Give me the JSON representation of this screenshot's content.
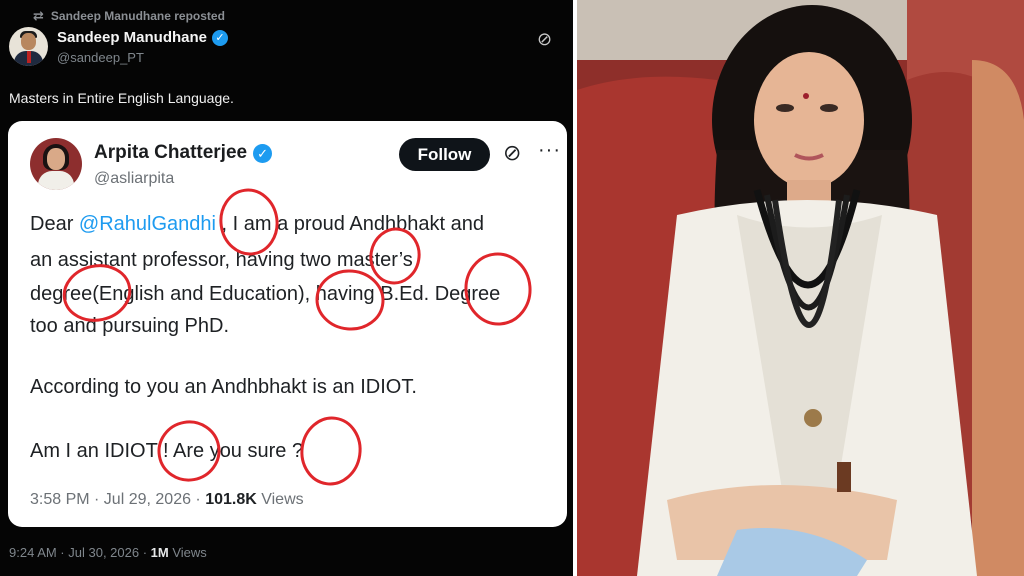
{
  "repost": {
    "text": "Sandeep Manudhane reposted"
  },
  "outer_tweet": {
    "name": "Sandeep Manudhane",
    "handle": "@sandeep_PT",
    "text": "Masters in Entire English Language.",
    "time": "9:24 AM · Jul 30, 2026 · ",
    "views_count": "1M",
    "views_label": " Views"
  },
  "quoted_tweet": {
    "name": "Arpita Chatterjee",
    "handle": "@asliarpita",
    "follow_label": "Follow",
    "more_label": "···",
    "lines": {
      "l1_pre": "Dear ",
      "l1_mention": "@RahulGandhi",
      "l1_post": " , I am a proud Andhbhakt and",
      "l2": "an assistant professor, having two master’s",
      "l3": "degree(English and Education), having B.Ed. Degree",
      "l4": "too and pursuing PhD.",
      "l5": "According to you an Andhbhakt is an IDIOT.",
      "l6": "Am I an IDIOT ! Are you sure ?"
    },
    "time": "3:58 PM · Jul 29, 2026 · ",
    "views_count": "101.8K",
    "views_label": " Views"
  },
  "annotation_color": "#e0262b",
  "icons": [
    "repost-icon",
    "verified-badge-icon",
    "grok-icon",
    "more-icon"
  ]
}
